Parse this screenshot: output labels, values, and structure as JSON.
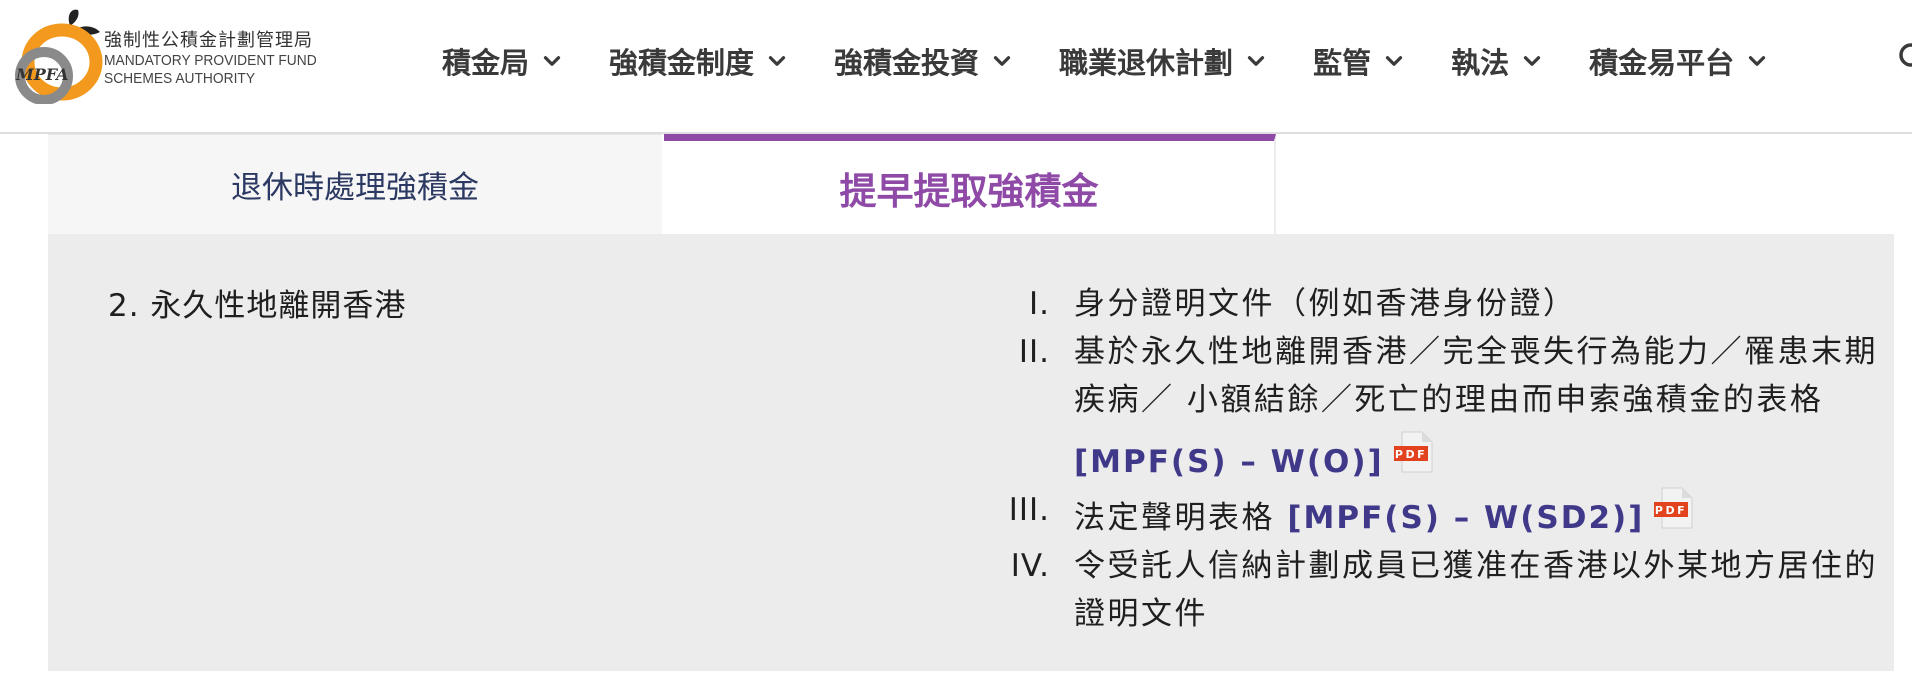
{
  "header": {
    "logo": {
      "abbr": "MPFA",
      "name_zh": "強制性公積金計劃管理局",
      "name_en_line1": "MANDATORY PROVIDENT FUND",
      "name_en_line2": "SCHEMES AUTHORITY"
    },
    "nav": [
      {
        "label": "積金局"
      },
      {
        "label": "強積金制度"
      },
      {
        "label": "強積金投資"
      },
      {
        "label": "職業退休計劃"
      },
      {
        "label": "監管"
      },
      {
        "label": "執法"
      },
      {
        "label": "積金易平台"
      }
    ]
  },
  "tabs": [
    {
      "label": "退休時處理強積金",
      "active": false
    },
    {
      "label": "提早提取強積金",
      "active": true
    }
  ],
  "content": {
    "reason": "2. 永久性地離開香港",
    "documents": [
      {
        "num": "I.",
        "text": "身分證明文件（例如香港身份證）"
      },
      {
        "num": "II.",
        "text": "基於永久性地離開香港／完全喪失行為能力／罹患末期疾病／ 小額結餘／死亡的理由而申索強積金的表格",
        "link": "[MPF(S) – W(O)]",
        "pdf_label": "PDF"
      },
      {
        "num": "III.",
        "text": "法定聲明表格 ",
        "link": "[MPF(S) – W(SD2)]",
        "pdf_label": "PDF"
      },
      {
        "num": "IV.",
        "text": "令受託人信納計劃成員已獲准在香港以外某地方居住的證明文件"
      }
    ]
  },
  "colors": {
    "accent_purple": "#8e4aa6",
    "link_blue": "#40398a",
    "tab_inactive_text": "#2c3a63",
    "panel_bg": "#ececec",
    "logo_orange": "#f39a1e",
    "pdf_red": "#e2431e"
  },
  "icons": {
    "nav_dropdown": "chevron-down-icon",
    "search": "search-icon",
    "pdf": "pdf-file-icon"
  }
}
